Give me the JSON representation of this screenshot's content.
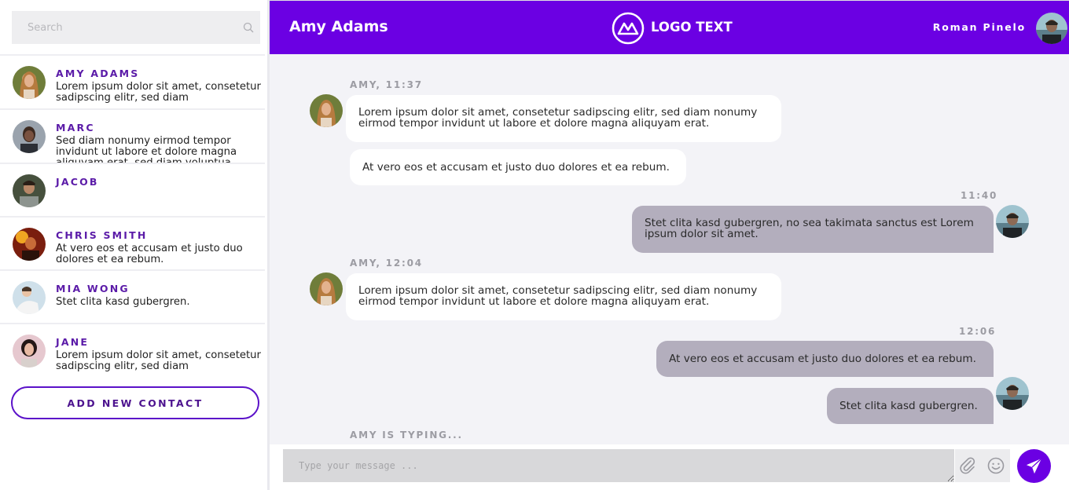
{
  "search": {
    "placeholder": "Search"
  },
  "contacts": [
    {
      "name": "AMY ADAMS",
      "preview": "Lorem ipsum dolor sit amet, consetetur sadipscing elitr, sed diam"
    },
    {
      "name": "MARC",
      "preview": "Sed diam nonumy eirmod tempor invidunt ut labore et dolore magna aliquyam erat, sed diam voluptua."
    },
    {
      "name": "JACOB",
      "preview": ""
    },
    {
      "name": "CHRIS SMITH",
      "preview": "At vero eos et accusam et justo duo dolores et ea rebum."
    },
    {
      "name": "MIA WONG",
      "preview": "Stet clita kasd gubergren."
    },
    {
      "name": "JANE",
      "preview": "Lorem ipsum dolor sit amet, consetetur sadipscing elitr, sed diam"
    }
  ],
  "add_contact_label": "ADD NEW CONTACT",
  "header": {
    "chat_title": "Amy Adams",
    "logo_text": "LOGO TEXT",
    "user_name": "Roman Pinelo"
  },
  "messages": {
    "meta1": "AMY, 11:37",
    "m1": "Lorem ipsum dolor sit amet, consetetur sadipscing elitr, sed diam nonumy eirmod tempor invidunt ut labore et dolore magna aliquyam erat.",
    "m2": "At vero eos et accusam et justo duo dolores et ea rebum.",
    "meta2": "11:40",
    "m3": "Stet clita kasd gubergren, no sea takimata sanctus est Lorem ipsum dolor sit amet.",
    "meta3": "AMY, 12:04",
    "m4": "Lorem ipsum dolor sit amet, consetetur sadipscing elitr, sed diam nonumy eirmod tempor invidunt ut labore et dolore magna aliquyam erat.",
    "meta4": "12:06",
    "m5": "At vero eos et accusam et justo duo dolores et ea rebum.",
    "m6": "Stet clita kasd gubergren."
  },
  "typing_indicator": "AMY IS TYPING...",
  "composer": {
    "placeholder": "Type your message ..."
  },
  "colors": {
    "accent": "#6b00e3",
    "contact_name": "#5b1ba8",
    "outgoing_bubble": "#b3aebd",
    "chat_bg": "#f3f3f7"
  }
}
